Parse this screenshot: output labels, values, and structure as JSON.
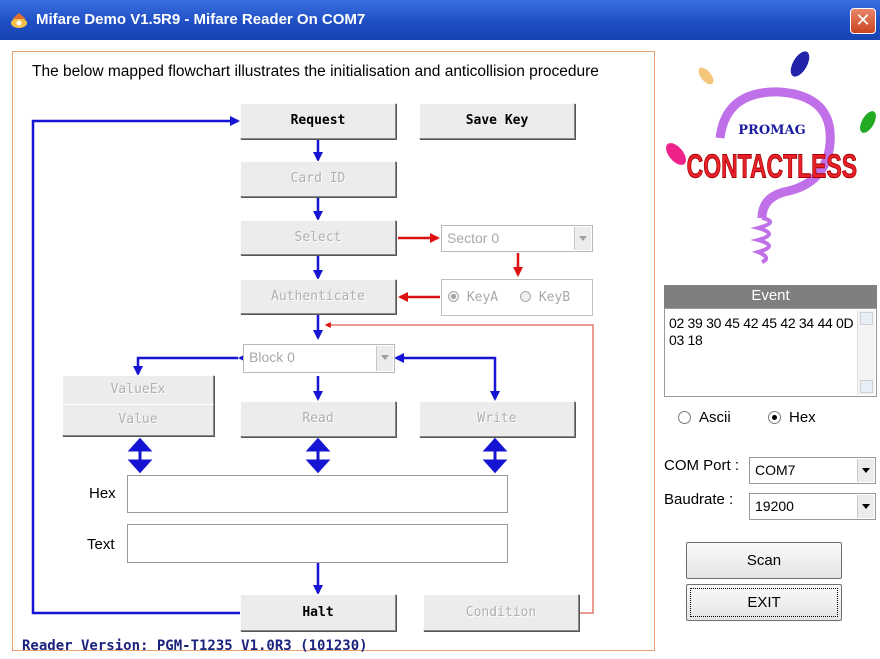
{
  "window": {
    "title": "Mifare Demo V1.5R9 - Mifare Reader On COM7",
    "app_icon": "mifare-app-icon",
    "close_icon": "close-icon"
  },
  "flowchart": {
    "description": "The below mapped flowchart illustrates the initialisation and anticollision procedure",
    "buttons": {
      "request": "Request",
      "save_key": "Save Key",
      "card_id": "Card ID",
      "select": "Select",
      "authenticate": "Authenticate",
      "value_ex": "ValueEx",
      "value": "Value",
      "read": "Read",
      "write": "Write",
      "halt": "Halt",
      "condition": "Condition"
    },
    "sector_select": {
      "value": "Sector 0"
    },
    "block_select": {
      "value": "Block 0"
    },
    "key_options": [
      {
        "label": "KeyA",
        "selected": true
      },
      {
        "label": "KeyB",
        "selected": false
      }
    ],
    "hex_label": "Hex",
    "hex_value": "",
    "text_label": "Text",
    "text_value": "",
    "enabled_buttons": [
      "Request",
      "Save Key",
      "Halt"
    ],
    "arrow_colors": {
      "main": "#1414d2",
      "secondary": "#dd1111",
      "frame": "#e8a070"
    }
  },
  "reader_version": "Reader Version: PGM-T1235 V1.0R3 (101230)",
  "logo": {
    "top_text": "PROMAG",
    "main_text": "CONTACTLESS"
  },
  "event": {
    "header": "Event",
    "text": "02 39 30 45 42 45 42 34 44 0D 03 18"
  },
  "display_format": {
    "options": [
      {
        "label": "Ascii",
        "selected": false
      },
      {
        "label": "Hex",
        "selected": true
      }
    ]
  },
  "com_port": {
    "label": "COM Port :",
    "value": "COM7"
  },
  "baudrate": {
    "label": "Baudrate :",
    "value": "19200"
  },
  "scan_button": "Scan",
  "exit_button": "EXIT"
}
